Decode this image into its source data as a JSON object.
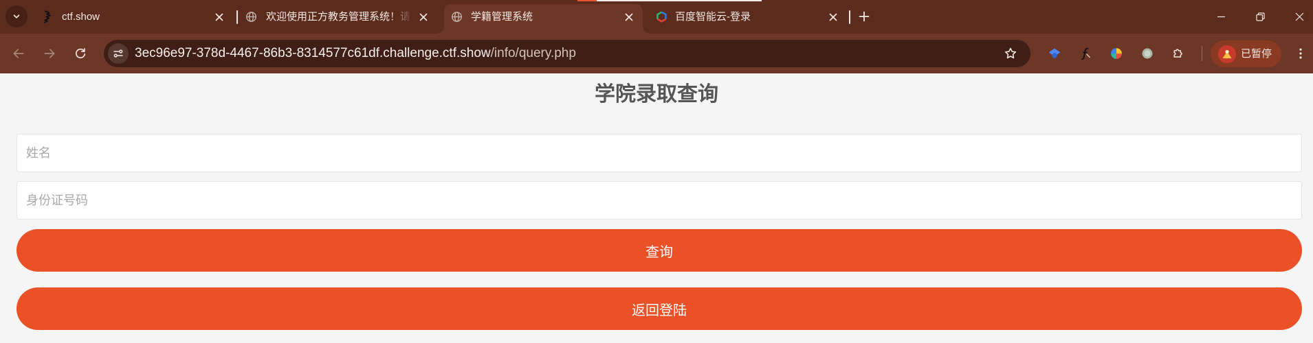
{
  "browser": {
    "tab_search_icon": "chevron-down-icon",
    "tabs": [
      {
        "title": "ctf.show",
        "icon": "ctf-show-favicon",
        "active": false
      },
      {
        "title": "欢迎使用正方教务管理系统！请",
        "icon": "globe-icon",
        "active": false
      },
      {
        "title": "学籍管理系统",
        "icon": "globe-icon",
        "active": true
      },
      {
        "title": "百度智能云-登录",
        "icon": "baidu-cloud-icon",
        "active": false
      }
    ],
    "new_tab_icon": "plus-icon",
    "window_controls": [
      "minimize-icon",
      "restore-icon",
      "close-icon"
    ],
    "toolbar": {
      "back_icon": "arrow-left-icon",
      "forward_icon": "arrow-right-icon",
      "reload_icon": "reload-icon",
      "back_enabled": false,
      "forward_enabled": false
    },
    "address_bar": {
      "site_info_icon": "tune-icon",
      "host": "3ec96e97-378d-4467-86b3-8314577c61df.challenge.ctf.show",
      "path": "/info/query.php",
      "bookmark_icon": "star-icon"
    },
    "extensions": [
      "blue-cap-extension-icon",
      "script-f-extension-icon",
      "color-orb-extension-icon",
      "gray-circle-extension-icon",
      "puzzle-icon"
    ],
    "profile": {
      "avatar_icon": "avatar-icon",
      "label": "已暂停"
    },
    "menu_icon": "kebab-menu-icon"
  },
  "page": {
    "title": "学院录取查询",
    "name_input": {
      "placeholder": "姓名",
      "value": ""
    },
    "id_input": {
      "placeholder": "身份证号码",
      "value": ""
    },
    "query_button": "查询",
    "back_to_login_button": "返回登陆"
  },
  "colors": {
    "tab_strip": "#5b2b1d",
    "toolbar": "#6d3727",
    "omnibox": "#3e1e15",
    "accent_button": "#eb5126",
    "page_background": "#f5f5f5",
    "title_text": "#555555"
  }
}
